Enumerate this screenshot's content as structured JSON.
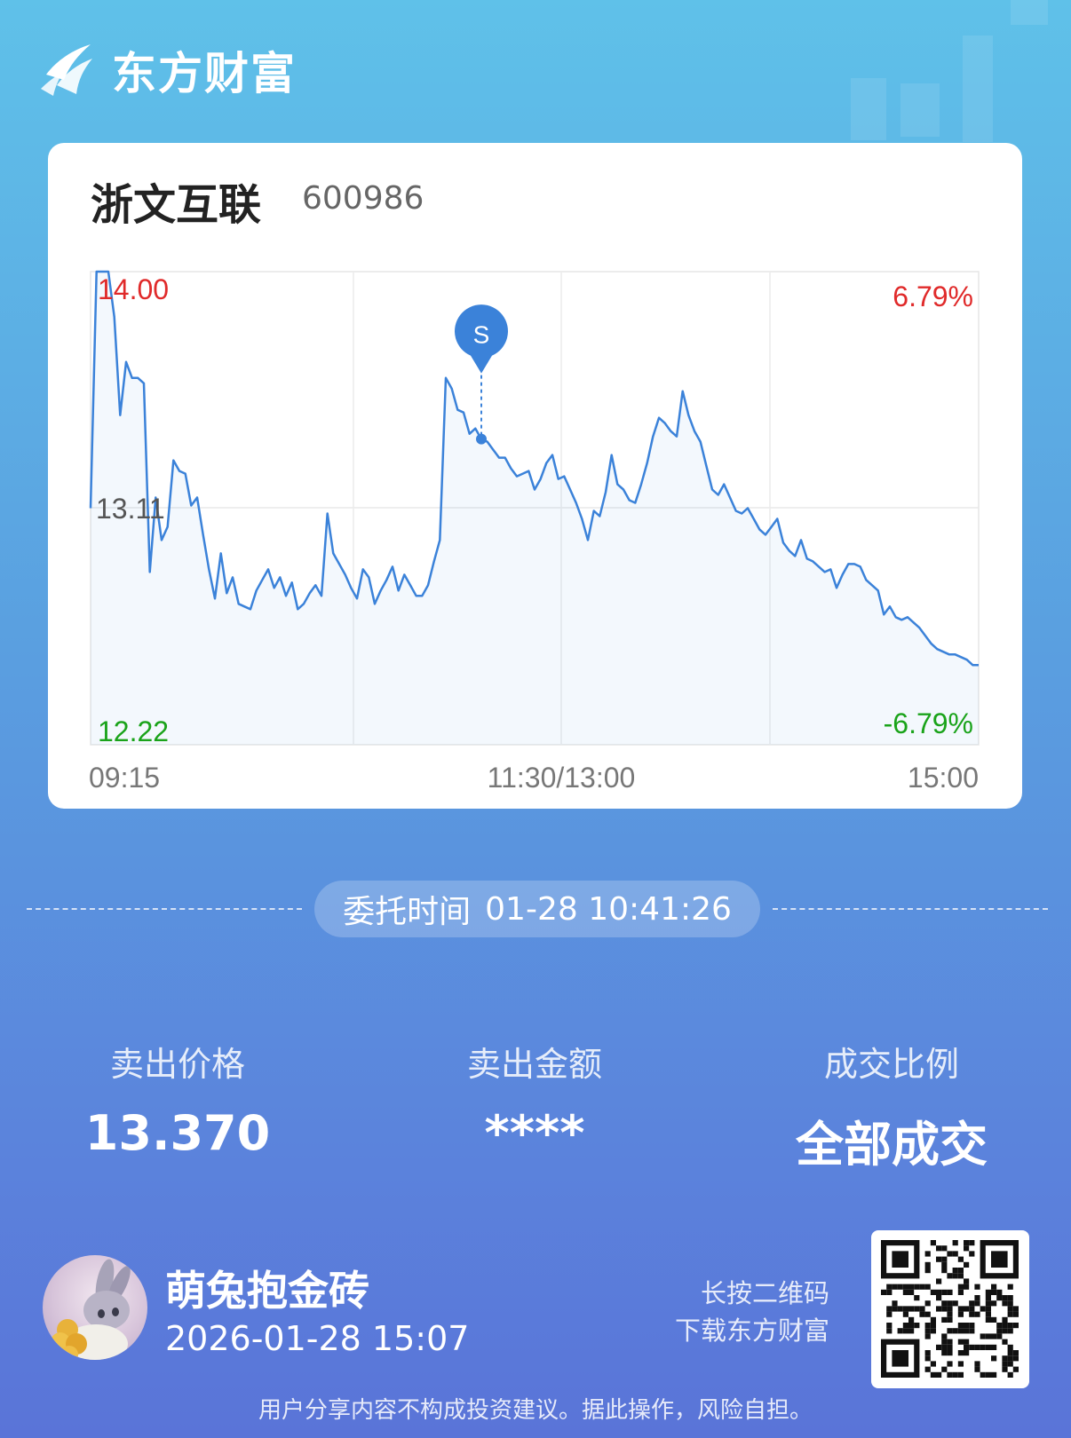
{
  "app": {
    "brand_name": "东方财富",
    "brand_color": "#ffffff"
  },
  "stock": {
    "name": "浙文互联",
    "code": "600986"
  },
  "chart_data": {
    "type": "line",
    "y_left_labels": {
      "high": "14.00",
      "mid": "13.11",
      "low": "12.22"
    },
    "y_right_labels": {
      "high": "6.79%",
      "low": "-6.79%"
    },
    "x_labels": {
      "start": "09:15",
      "mid": "11:30/13:00",
      "end": "15:00"
    },
    "ylim": [
      12.22,
      14.0
    ],
    "prev_close": 13.11,
    "marker": {
      "label": "S",
      "price": 13.37,
      "time": "10:41"
    },
    "line_color": "#3b82d9",
    "up_color": "#e02a2a",
    "down_color": "#1aa31a",
    "series": [
      {
        "values": [
          13.11,
          14.0,
          14.0,
          14.0,
          13.83,
          13.46,
          13.66,
          13.6,
          13.6,
          13.58,
          12.87,
          13.15,
          12.99,
          13.04,
          13.29,
          13.25,
          13.24,
          13.12,
          13.15,
          13.01,
          12.88,
          12.77,
          12.94,
          12.79,
          12.85,
          12.75,
          12.74,
          12.73,
          12.8,
          12.84,
          12.88,
          12.81,
          12.85,
          12.78,
          12.83,
          12.73,
          12.75,
          12.79,
          12.82,
          12.78,
          13.09,
          12.94,
          12.9,
          12.86,
          12.81,
          12.77,
          12.88,
          12.85,
          12.75,
          12.8,
          12.84,
          12.89,
          12.8,
          12.86,
          12.82,
          12.78,
          12.78,
          12.82,
          12.91,
          12.99,
          13.6,
          13.56,
          13.48,
          13.47,
          13.39,
          13.41,
          13.37,
          13.36,
          13.33,
          13.3,
          13.3,
          13.26,
          13.23,
          13.24,
          13.25,
          13.18,
          13.22,
          13.28,
          13.31,
          13.22,
          13.23,
          13.18,
          13.13,
          13.07,
          12.99,
          13.1,
          13.08,
          13.17,
          13.31,
          13.2,
          13.18,
          13.14,
          13.13,
          13.2,
          13.28,
          13.38,
          13.45,
          13.43,
          13.4,
          13.38,
          13.55,
          13.46,
          13.4,
          13.36,
          13.27,
          13.18,
          13.16,
          13.2,
          13.15,
          13.1,
          13.09,
          13.11,
          13.07,
          13.03,
          13.01,
          13.04,
          13.07,
          12.98,
          12.95,
          12.93,
          12.99,
          12.92,
          12.91,
          12.89,
          12.87,
          12.88,
          12.81,
          12.86,
          12.9,
          12.9,
          12.89,
          12.84,
          12.82,
          12.8,
          12.71,
          12.74,
          12.7,
          12.69,
          12.7,
          12.68,
          12.66,
          12.63,
          12.6,
          12.58,
          12.57,
          12.56,
          12.56,
          12.55,
          12.54,
          12.52,
          12.52
        ]
      }
    ]
  },
  "order": {
    "time_label": "委托时间",
    "time_value": "01-28 10:41:26"
  },
  "stats": [
    {
      "label": "卖出价格",
      "value": "13.370"
    },
    {
      "label": "卖出金额",
      "value": "****"
    },
    {
      "label": "成交比例",
      "value": "全部成交"
    }
  ],
  "user": {
    "name": "萌兔抱金砖",
    "timestamp": "2026-01-28 15:07"
  },
  "qr": {
    "tip_line1": "长按二维码",
    "tip_line2": "下载东方财富"
  },
  "disclaimer": "用户分享内容不构成投资建议。据此操作，风险自担。"
}
